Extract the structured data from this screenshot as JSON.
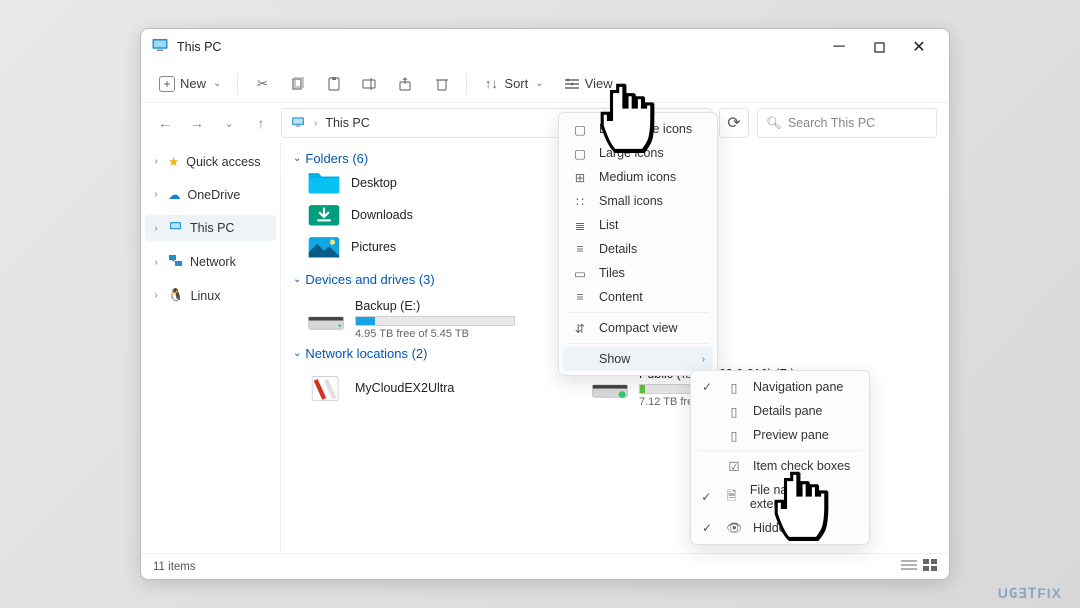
{
  "titlebar": {
    "title": "This PC"
  },
  "toolbar": {
    "new_label": "New",
    "sort_label": "Sort",
    "view_label": "View"
  },
  "nav": {
    "breadcrumb_root": "This PC"
  },
  "search": {
    "placeholder": "Search This PC"
  },
  "sidebar": {
    "items": [
      {
        "label": "Quick access"
      },
      {
        "label": "OneDrive"
      },
      {
        "label": "This PC"
      },
      {
        "label": "Network"
      },
      {
        "label": "Linux"
      }
    ]
  },
  "groups": {
    "folders_header": "Folders (6)",
    "folders": [
      {
        "label": "Desktop"
      },
      {
        "label": "Downloads"
      },
      {
        "label": "Pictures"
      }
    ],
    "drives_header": "Devices and drives (3)",
    "drives": [
      {
        "name": "Backup (E:)",
        "free": "4.95 TB free of 5.45 TB",
        "fill_pct": 12,
        "fill_color": "#18a3e6"
      }
    ],
    "netloc_header": "Network locations (2)",
    "netloc": [
      {
        "name": "MyCloudEX2Ultra"
      },
      {
        "name": "Public (\\\\192.168.0.216) (Z:)",
        "free": "7.12 TB free of 7.21 TB",
        "fill_pct": 3,
        "fill_color": "#5fbf3f"
      }
    ]
  },
  "status": {
    "text": "11 items"
  },
  "view_menu": {
    "items": [
      {
        "label": "Extra large icons"
      },
      {
        "label": "Large icons"
      },
      {
        "label": "Medium icons"
      },
      {
        "label": "Small icons"
      },
      {
        "label": "List"
      },
      {
        "label": "Details"
      },
      {
        "label": "Tiles"
      },
      {
        "label": "Content"
      },
      {
        "label": "Compact view"
      },
      {
        "label": "Show"
      }
    ]
  },
  "show_menu": {
    "items": [
      {
        "label": "Navigation pane",
        "checked": true
      },
      {
        "label": "Details pane",
        "checked": false
      },
      {
        "label": "Preview pane",
        "checked": false
      },
      {
        "label": "Item check boxes",
        "checked": false
      },
      {
        "label": "File name extensions",
        "checked": true
      },
      {
        "label": "Hidden items",
        "checked": true
      }
    ]
  },
  "watermark": "UGETFIX"
}
